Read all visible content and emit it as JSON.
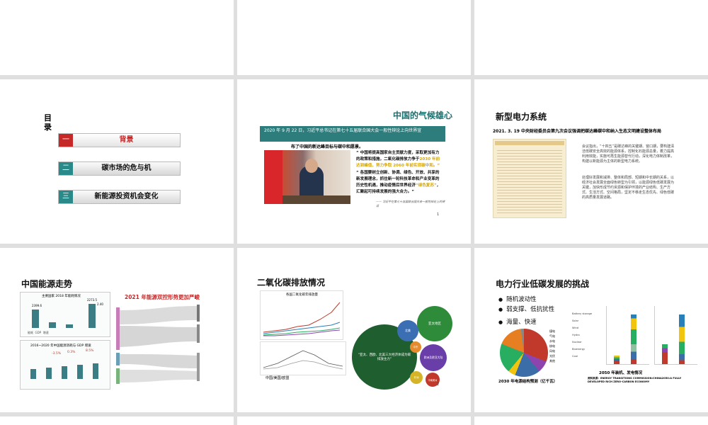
{
  "toc": {
    "title": "目录",
    "items": [
      {
        "num": "一",
        "label": "背景"
      },
      {
        "num": "二",
        "label": "碳市场的危与机"
      },
      {
        "num": "三",
        "label": "新能源投资机会变化"
      }
    ]
  },
  "climate": {
    "title": "中国的气候雄心",
    "banner": "2020 年 9 月 22 日，习近平总书记在第七十五届联合国大会一般性辩论上向世界宣",
    "banner_cont": "布了中国的新达峰目标与碳中和愿景。",
    "quote1": "“ 中国将提高国家自主贡献力度，采取更加有力的政策和措施，二氧化碳排放力争于",
    "quote1_hl": "2030 年前达到峰值，努力争取 2060 年前实现碳中和。”",
    "quote2": "“ 各国要树立创新、协调、绿色、开放、共享的新发展理念，抓住新一轮科技革命和产业变革的历史性机遇，推动疫情后世界经济",
    "quote2_hl": "“绿色复苏”",
    "quote2_end": "，汇聚起可持续发展的强大合力。”",
    "source": "—— 习近平在第七十五届联合国大会一般性辩论上的讲话",
    "page": "1"
  },
  "power": {
    "title": "新型电力系统",
    "subtitle": "2021. 3. 19 中央财经委员会第九次会议强调把碳达峰碳中和纳入生态文明建设整体布局",
    "para1": "会议指出，“十四五”是碳达峰的关键期、窗口期，要构建清洁低碳安全高效的能源体系，控制化石能源总量，着力提高利用效能，实施可再生能源替代行动，深化电力体制改革，构建以新能源为主体的新型电力系统。",
    "para2": "处理好发展和减排、整体和局部、短期和中长期的关系，以经济社会发展全面绿色转型为引领，以能源绿色低碳发展为关键，加快形成节约资源和保护环境的产业结构、生产方式、生活方式、空间格局，坚定不移走生态优先、绿色低碳的高质量发展道路。"
  },
  "energy": {
    "title": "中国能源走势",
    "chart1_title": "主要国家 2018 年能耗情况",
    "chart2_title": "2016~2020 年中国能源消耗与 GDP 增速",
    "sankey_title": "2021 年能源双控形势更加严峻",
    "bar_labels": [
      "2399.6",
      "2273.5",
      "2.40"
    ],
    "pct_labels": [
      "-3.5%",
      "0.3%",
      "8.5%"
    ],
    "legend": [
      "能耗",
      "GDP",
      "增速"
    ]
  },
  "co2": {
    "title": "二氧化碳排放情况",
    "line_title": "各国二氧化碳年排放量",
    "bubble_labels": [
      "亚太地区",
      "北美",
      "欧洲及欧亚大陆",
      "中东",
      "非洲",
      "中南美洲"
    ],
    "bubble_main": "“亚太、西欧、北美三大经济体成为碳排放主力”",
    "footer": "中国/美国/欧盟",
    "page": "2"
  },
  "challenge": {
    "title": "电力行业低碳发展的挑战",
    "bullets": [
      "随机波动性",
      "弱支撑、低抗扰性",
      "海量、快速"
    ],
    "pie_caption": "2030 年电源结构预测（亿千瓦）",
    "bar_caption": "2050 年装机、发电情况",
    "bar_source": "资料来源：ENERGY TRANSITIONS COMMISSION:CHINA2050:A FULLY DEVELOPED RICH ZERO-CARBON ECONOMY",
    "pie_legend": [
      "煤电",
      "气电",
      "水电",
      "核电",
      "风电",
      "光伏",
      "其他"
    ],
    "stack_legend": [
      "Battery storage",
      "Solar",
      "Wind",
      "Hydro",
      "Nuclear",
      "Bioenergy",
      "Coal"
    ],
    "pie_values": [
      0.31,
      0.08,
      0.17,
      0.05,
      0.2,
      0.17,
      0.02
    ],
    "colors": {
      "coal": "#c0392b",
      "gas": "#8e44ad",
      "hydro": "#3b6ea8",
      "nuclear": "#f1c40f",
      "wind": "#27ae60",
      "solar": "#e67e22",
      "other": "#7f8c8d"
    }
  }
}
